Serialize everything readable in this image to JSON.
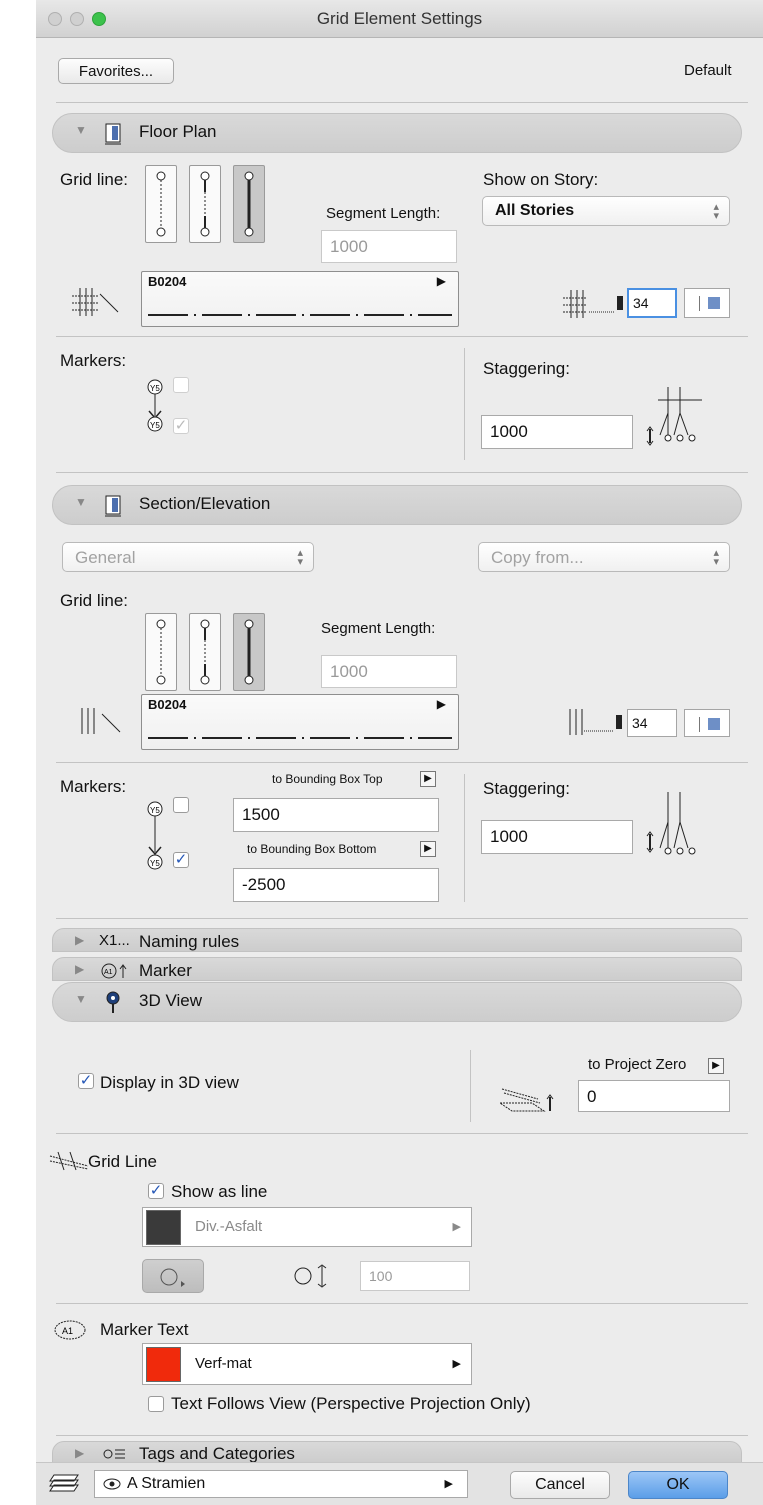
{
  "window": {
    "title": "Grid Element Settings"
  },
  "top": {
    "favorites_label": "Favorites...",
    "default_label": "Default"
  },
  "floor_plan": {
    "header": "Floor Plan",
    "grid_line_label": "Grid line:",
    "segment_length_label": "Segment Length:",
    "segment_length_value": "1000",
    "line_type_code": "B0204",
    "show_on_story_label": "Show on Story:",
    "show_on_story_value": "All Stories",
    "pen_value": "34",
    "markers_label": "Markers:",
    "marker_icon_text": "Y5",
    "staggering_label": "Staggering:",
    "staggering_value": "1000"
  },
  "section": {
    "header": "Section/Elevation",
    "general_select": "General",
    "copy_from_select": "Copy from...",
    "grid_line_label": "Grid line:",
    "segment_length_label": "Segment Length:",
    "segment_length_value": "1000",
    "line_type_code": "B0204",
    "pen_value": "34",
    "markers_label": "Markers:",
    "to_top_label": "to Bounding Box Top",
    "to_top_value": "1500",
    "to_bottom_label": "to Bounding Box Bottom",
    "to_bottom_value": "-2500",
    "staggering_label": "Staggering:",
    "staggering_value": "1000"
  },
  "naming_rules": {
    "icon_text": "X1...",
    "header": "Naming rules"
  },
  "marker_panel": {
    "header": "Marker"
  },
  "view3d": {
    "header": "3D View",
    "display_label": "Display in 3D view",
    "to_project_zero_label": "to Project Zero",
    "to_project_zero_value": "0",
    "grid_line_label": "Grid Line",
    "show_as_line_label": "Show as line",
    "material_name": "Div.-Asfalt",
    "material_color": "#3a3a3a",
    "thickness_value": "100",
    "marker_text_label": "Marker Text",
    "text_material_name": "Verf-mat",
    "text_material_color": "#f02a0c",
    "text_follows_label": "Text Follows View (Perspective Projection Only)"
  },
  "tags": {
    "header": "Tags and Categories"
  },
  "footer": {
    "layer_name": "A Stramien",
    "cancel_label": "Cancel",
    "ok_label": "OK"
  },
  "colors": {
    "accent": "#4a90e2",
    "close": "#fc605b",
    "minimize": "#fdbc40",
    "zoom": "#34c84a"
  }
}
